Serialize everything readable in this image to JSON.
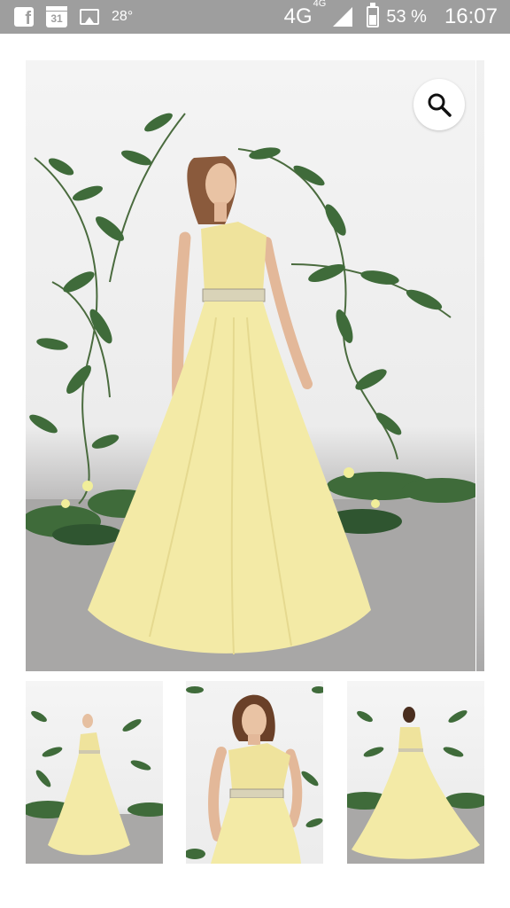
{
  "status_bar": {
    "temperature": "28°",
    "calendar_day": "31",
    "network": "4G",
    "network_small": "4G",
    "battery_percent": "53 %",
    "battery_level": 0.53,
    "time": "16:07"
  },
  "gallery": {
    "main_image": "yellow one-shoulder tulle gown with belt, front view",
    "zoom_icon": "magnifier-icon",
    "thumbnails": [
      {
        "image": "full-length front view"
      },
      {
        "image": "close-up front view"
      },
      {
        "image": "back view with train"
      }
    ]
  },
  "colors": {
    "status_bar": "#9e9e9e",
    "dress": "#f3eaa6",
    "foliage": "#3f6b3a"
  }
}
